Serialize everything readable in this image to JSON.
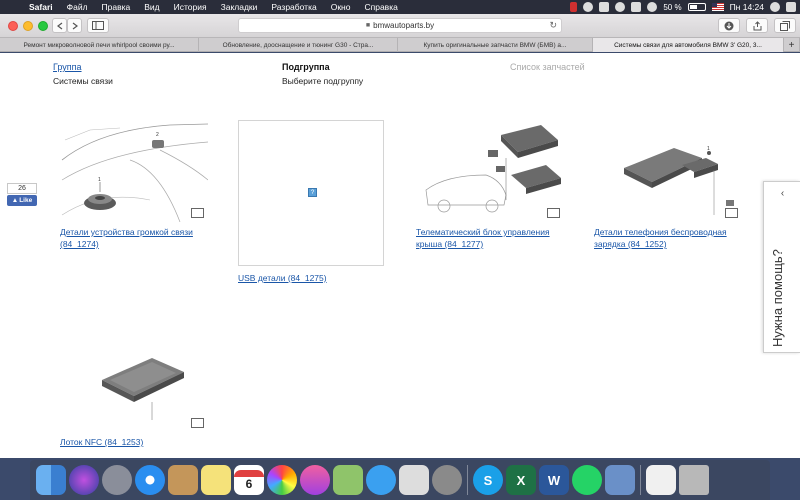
{
  "menubar": {
    "app": "Safari",
    "items": [
      "Файл",
      "Правка",
      "Вид",
      "История",
      "Закладки",
      "Разработка",
      "Окно",
      "Справка"
    ],
    "battery": "50 %",
    "clock": "Пн 14:24"
  },
  "browser": {
    "url": "bmwautoparts.by",
    "tabs": [
      {
        "title": "Ремонт микроволновой печи whirlpool своими ру..."
      },
      {
        "title": "Обновление, дооснащение и тюнинг G30 - Стра..."
      },
      {
        "title": "Купить оригинальные запчасти BMW (БМВ) a..."
      },
      {
        "title": "Системы связи для автомобиля BMW 3' G20, 3...",
        "active": true
      }
    ]
  },
  "breadcrumb": {
    "group": {
      "heading": "Группа",
      "value": "Системы связи"
    },
    "subgroup": {
      "heading": "Подгруппа",
      "value": "Выберите подгруппу"
    },
    "parts": {
      "heading": "Список запчастей"
    }
  },
  "parts": [
    {
      "label": "Детали устройства громкой связи (84_1274)"
    },
    {
      "label": "USB детали (84_1275)",
      "image_missing": true
    },
    {
      "label": "Телематический блок управления крыша (84_1277)"
    },
    {
      "label": "Детали телефония беспроводная зарядка (84_1252)"
    },
    {
      "label": "Лоток NFC (84_1253)"
    }
  ],
  "facebook": {
    "count": "26",
    "like": "Like"
  },
  "help_widget": {
    "text": "Нужна помощь?"
  },
  "dock": {
    "icons": [
      "finder-icon",
      "siri-icon",
      "launchpad-icon",
      "safari-icon",
      "notes-icon",
      "stickies-icon",
      "calendar-icon",
      "photos-icon",
      "music-icon",
      "maps-icon",
      "messages-icon",
      "preview-icon",
      "system-preferences-icon",
      "skype-icon",
      "excel-icon",
      "word-icon",
      "whatsapp-icon",
      "photo-viewer-icon",
      "printer-icon",
      "trash-icon"
    ],
    "calendar_day": "6"
  }
}
